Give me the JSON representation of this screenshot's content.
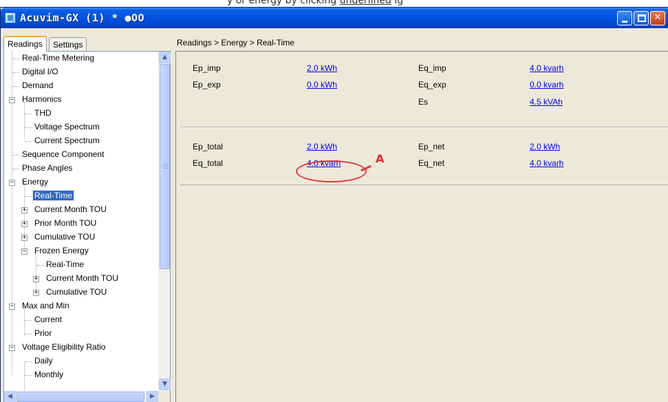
{
  "caption": {
    "text": "y or energy by clicking ",
    "link": "underlined",
    "suffix": " ig"
  },
  "window": {
    "title": "Acuvim-GX (1) * ●OO"
  },
  "tabs": [
    {
      "label": "Readings"
    },
    {
      "label": "Settings"
    }
  ],
  "tree": [
    {
      "label": "Real-Time Metering"
    },
    {
      "label": "Digital I/O"
    },
    {
      "label": "Demand"
    },
    {
      "label": "Harmonics"
    },
    {
      "label": "THD"
    },
    {
      "label": "Voltage Spectrum"
    },
    {
      "label": "Current Spectrum"
    },
    {
      "label": "Sequence Component"
    },
    {
      "label": "Phase Angles"
    },
    {
      "label": "Energy"
    },
    {
      "label": "Real-Time"
    },
    {
      "label": "Current Month TOU"
    },
    {
      "label": "Prior Month TOU"
    },
    {
      "label": "Cumulative TOU"
    },
    {
      "label": "Frozen Energy"
    },
    {
      "label": "Real-Time"
    },
    {
      "label": "Current Month TOU"
    },
    {
      "label": "Cumulative TOU"
    },
    {
      "label": "Max and Min"
    },
    {
      "label": "Current"
    },
    {
      "label": "Prior"
    },
    {
      "label": "Voltage Eligibility Ratio"
    },
    {
      "label": "Daily"
    },
    {
      "label": "Monthly"
    }
  ],
  "breadcrumb": "Readings > Energy > Real-Time",
  "energy": {
    "row1": {
      "label1": "Ep_imp",
      "value1": "2.0 kWh",
      "label2": "Eq_imp",
      "value2": "4.0 kvarh"
    },
    "row2": {
      "label1": "Ep_exp",
      "value1": "0.0 kWh",
      "label2": "Eq_exp",
      "value2": "0.0 kvarh"
    },
    "row3": {
      "label2": "Es",
      "value2": "4.5 kVAh"
    },
    "row4": {
      "label1": "Ep_total",
      "value1": "2.0 kWh",
      "label2": "Ep_net",
      "value2": "2.0 kWh"
    },
    "row5": {
      "label1": "Eq_total",
      "value1": "4.0 kvarh",
      "label2": "Eq_net",
      "value2": "4.0 kvarh"
    }
  },
  "annotation": {
    "letter": "A"
  },
  "colors": {
    "titlebar": "#0052e0",
    "link": "#0000ee",
    "selection": "#316ac5",
    "annotation": "#e8343a"
  }
}
